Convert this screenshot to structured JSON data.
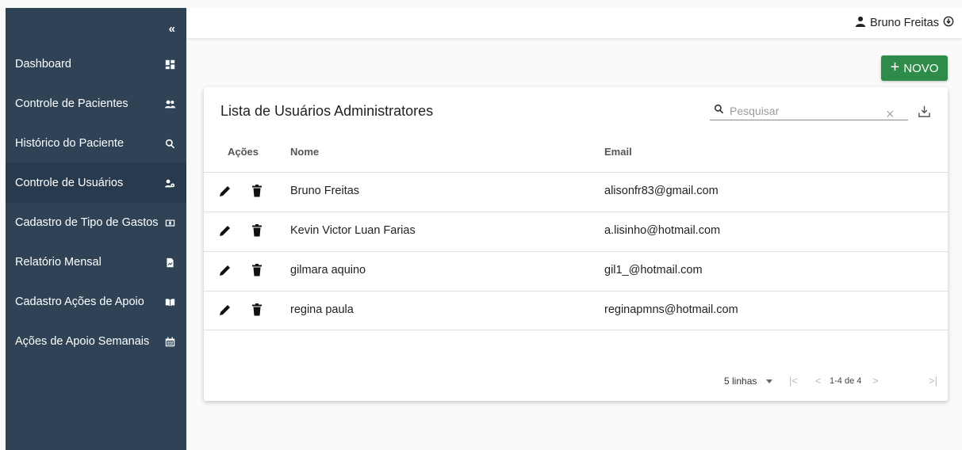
{
  "sidebar": {
    "collapse_label": "«",
    "items": [
      {
        "label": "Dashboard",
        "icon": "dashboard-icon"
      },
      {
        "label": "Controle de Pacientes",
        "icon": "users-icon"
      },
      {
        "label": "Histórico do Paciente",
        "icon": "search-icon"
      },
      {
        "label": "Controle de Usuários",
        "icon": "user-cog-icon"
      },
      {
        "label": "Cadastro de Tipo de Gastos",
        "icon": "money-icon"
      },
      {
        "label": "Relatório Mensal",
        "icon": "report-icon"
      },
      {
        "label": "Cadastro Ações de Apoio",
        "icon": "book-icon"
      },
      {
        "label": "Ações de Apoio Semanais",
        "icon": "calendar-icon"
      }
    ]
  },
  "topbar": {
    "user_name": "Bruno Freitas"
  },
  "actions": {
    "new_label": "NOVO",
    "new_plus": "+"
  },
  "table": {
    "title": "Lista de Usuários Administratores",
    "search_placeholder": "Pesquisar",
    "clear_label": "×",
    "columns": {
      "actions": "Ações",
      "name": "Nome",
      "email": "Email"
    },
    "rows": [
      {
        "name": "Bruno Freitas",
        "email": "alisonfr83@gmail.com"
      },
      {
        "name": "Kevin Victor Luan Farias",
        "email": "a.lisinho@hotmail.com"
      },
      {
        "name": "gilmara aquino",
        "email": "gil1_@hotmail.com"
      },
      {
        "name": "regina paula",
        "email": "reginapmns@hotmail.com"
      }
    ],
    "footer": {
      "rows_per_page": "5 linhas",
      "range": "1-4 de 4",
      "first": "|<",
      "prev": "<",
      "next": ">",
      "last": ">|"
    }
  },
  "colors": {
    "sidebar": "#2f4256",
    "sidebar_active": "#283a4d",
    "accent": "#2e8b4a"
  }
}
